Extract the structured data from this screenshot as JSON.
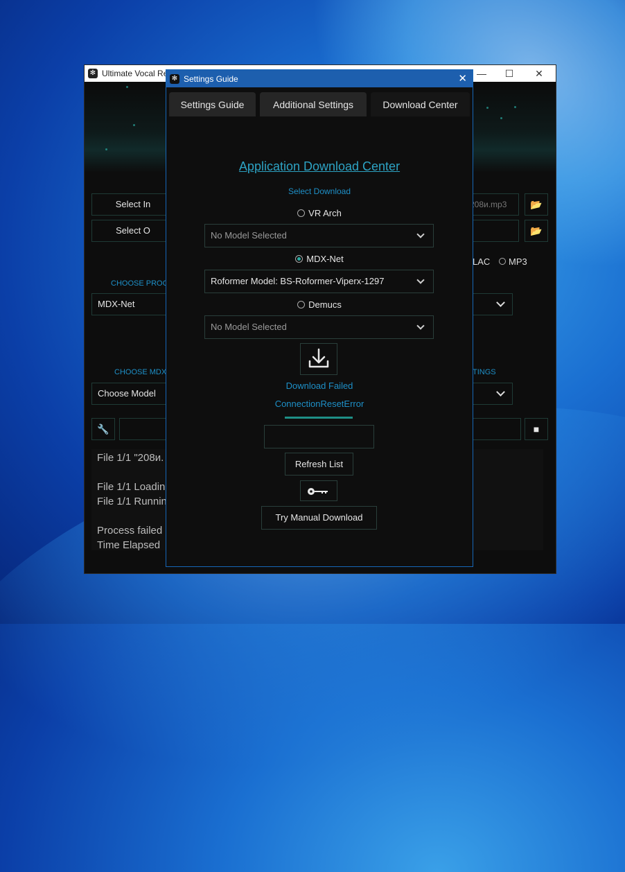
{
  "main_window": {
    "title": "Ultimate Vocal Re",
    "select_input_label": "Select In",
    "select_output_label": "Select O",
    "input_path_tail": "208и.mp3",
    "format_flac_partial": "LAC",
    "format_mp3": "MP3",
    "choose_process_label": "CHOOSE PROC",
    "process_method_value": "MDX-Net",
    "choose_mdx_label": "CHOOSE MDX",
    "settings_label_partial": "TINGS",
    "choose_model_value": "Choose Model",
    "console_lines": [
      "File 1/1 \"208и.",
      "",
      "File 1/1 Loadin",
      "File 1/1 Runnin",
      "",
      "Process failed",
      "Time Elapsed"
    ]
  },
  "dialog": {
    "title": "Settings Guide",
    "tabs": [
      {
        "label": "Settings Guide"
      },
      {
        "label": "Additional Settings"
      },
      {
        "label": "Download Center"
      }
    ],
    "heading": "Application Download Center",
    "select_download_label": "Select Download",
    "vr_arch": {
      "label": "VR Arch",
      "selected": false,
      "model_value": "No Model Selected"
    },
    "mdx_net": {
      "label": "MDX-Net",
      "selected": true,
      "model_value": "Roformer Model: BS-Roformer-Viperx-1297"
    },
    "demucs": {
      "label": "Demucs",
      "selected": false,
      "model_value": "No Model Selected"
    },
    "download_status": "Download Failed",
    "error_text": "ConnectionResetError",
    "progress": 1.0,
    "refresh_label": "Refresh List",
    "manual_download_label": "Try Manual Download",
    "accent_color": "#1e90c8",
    "progress_color": "#1e8f86"
  }
}
